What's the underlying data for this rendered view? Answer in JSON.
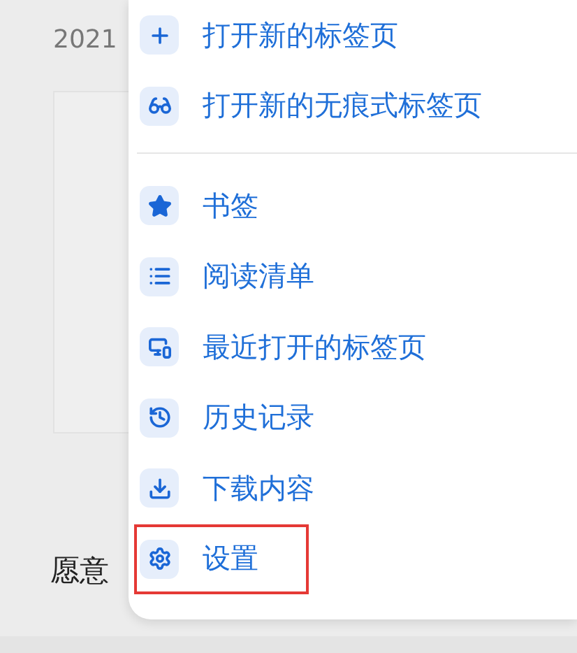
{
  "page": {
    "date": "2021",
    "line": "愿意"
  },
  "menu": {
    "sections": [
      {
        "items": [
          {
            "label": "打开新的标签页",
            "highlighted": false
          },
          {
            "label": "打开新的无痕式标签页",
            "highlighted": false
          }
        ]
      },
      {
        "items": [
          {
            "label": "书签",
            "highlighted": false
          },
          {
            "label": "阅读清单",
            "highlighted": false
          },
          {
            "label": "最近打开的标签页",
            "highlighted": false
          },
          {
            "label": "历史记录",
            "highlighted": false
          },
          {
            "label": "下载内容",
            "highlighted": false
          },
          {
            "label": "设置",
            "highlighted": true
          }
        ]
      }
    ]
  }
}
